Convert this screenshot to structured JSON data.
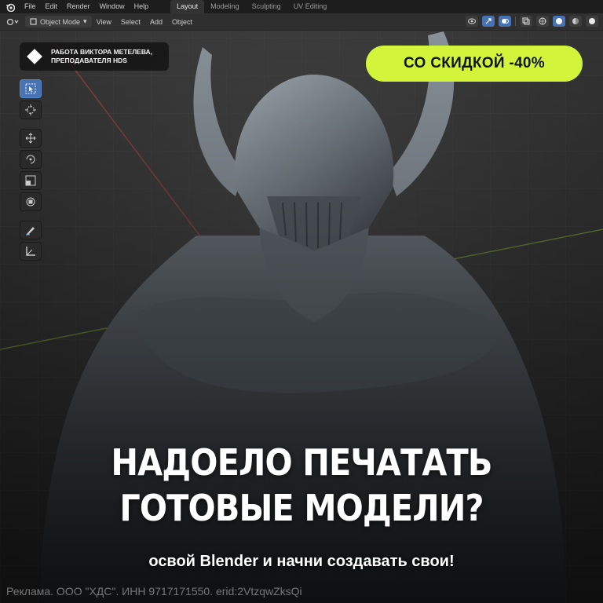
{
  "menubar": {
    "items": [
      "File",
      "Edit",
      "Render",
      "Window",
      "Help"
    ],
    "workspaces": [
      "Layout",
      "Modeling",
      "Sculpting",
      "UV Editing"
    ],
    "active_workspace": "Layout"
  },
  "header": {
    "mode": "Object Mode",
    "menus": [
      "View",
      "Select",
      "Add",
      "Object"
    ]
  },
  "toolbar": {
    "tools": [
      "select-box",
      "cursor",
      "move",
      "rotate",
      "scale",
      "transform",
      "annotate",
      "measure"
    ],
    "active": "select-box"
  },
  "ad": {
    "author_badge": "РАБОТА ВИКТОРА МЕТЕЛЕВА,\nПРЕПОДАВАТЕЛЯ HDS",
    "author_line1": "РАБОТА ВИКТОРА МЕТЕЛЕВА,",
    "author_line2": "ПРЕПОДАВАТЕЛЯ HDS",
    "discount": "СО СКИДКОЙ -40%",
    "headline_line1": "НАДОЕЛО ПЕЧАТАТЬ",
    "headline_line2": "ГОТОВЫЕ МОДЕЛИ?",
    "subline": "освой Blender и начни создавать свои!",
    "disclaimer": "Реклама. ООО \"ХДС\". ИНН 9717171550. erid:2VtzqwZksQi"
  },
  "colors": {
    "accent": "#d2f53c",
    "blender_active": "#4772b3",
    "viewport_bg": "#393939"
  }
}
